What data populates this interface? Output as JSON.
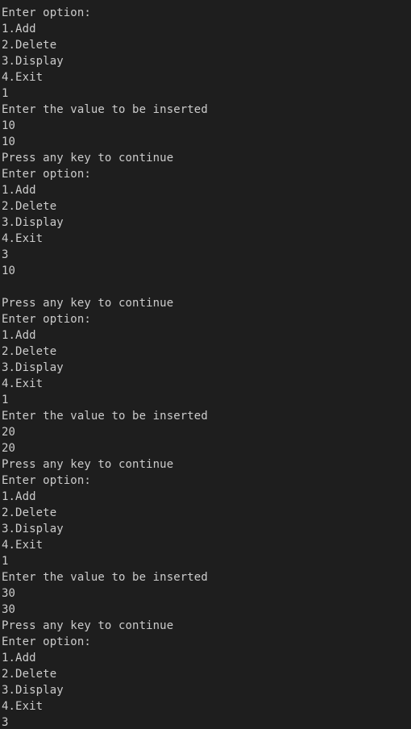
{
  "terminal": {
    "lines": [
      "Enter option:",
      "1.Add",
      "2.Delete",
      "3.Display",
      "4.Exit",
      "1",
      "Enter the value to be inserted",
      "10",
      "10",
      "Press any key to continue",
      "Enter option:",
      "1.Add",
      "2.Delete",
      "3.Display",
      "4.Exit",
      "3",
      "10",
      "",
      "Press any key to continue",
      "Enter option:",
      "1.Add",
      "2.Delete",
      "3.Display",
      "4.Exit",
      "1",
      "Enter the value to be inserted",
      "20",
      "20",
      "Press any key to continue",
      "Enter option:",
      "1.Add",
      "2.Delete",
      "3.Display",
      "4.Exit",
      "1",
      "Enter the value to be inserted",
      "30",
      "30",
      "Press any key to continue",
      "Enter option:",
      "1.Add",
      "2.Delete",
      "3.Display",
      "4.Exit",
      "3"
    ]
  },
  "colors": {
    "background": "#1e1e1e",
    "text": "#cccccc"
  }
}
